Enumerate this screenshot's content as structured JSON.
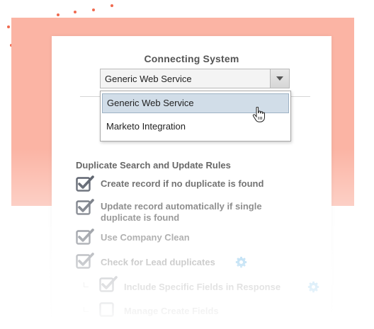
{
  "connecting_system": {
    "label": "Connecting System",
    "selected_value": "Generic Web Service",
    "options": [
      "Generic Web Service",
      "Marketo Integration"
    ]
  },
  "rules": {
    "title": "Duplicate Search and Update Rules",
    "items": [
      {
        "label": "Create record if no duplicate is found",
        "checked": true
      },
      {
        "label": "Update record automatically if single",
        "label_line2": "duplicate is found",
        "checked": true
      },
      {
        "label": "Use Company Clean",
        "checked": true
      },
      {
        "label": "Check for Lead duplicates",
        "checked": true,
        "icon": "gear-icon"
      },
      {
        "label": "Include Specific Fields in Response",
        "checked": true,
        "icon": "gear-icon"
      },
      {
        "label": "Manage Create Fields",
        "checked": false
      }
    ]
  },
  "colors": {
    "accent_salmon": "#fbb4a4",
    "dot_orange": "#f06a4f",
    "gear_blue": "#3ea3e0",
    "check_dark": "#3c4350"
  }
}
